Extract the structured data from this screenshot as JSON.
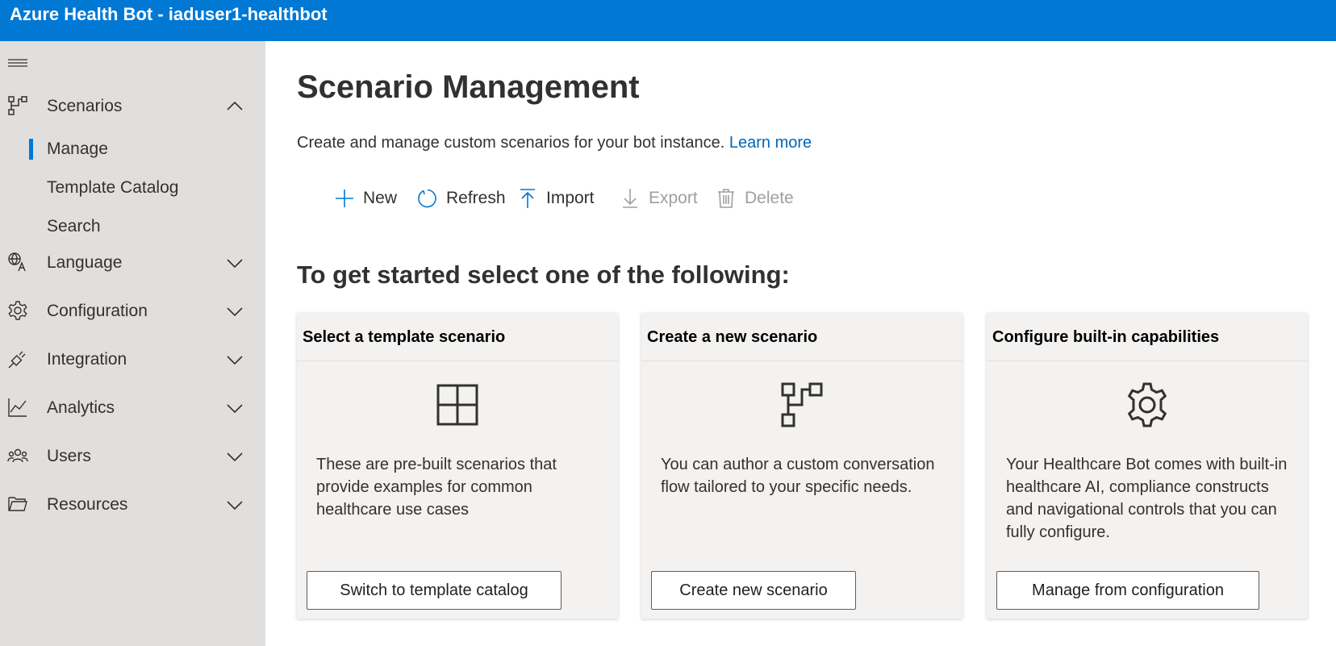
{
  "app": {
    "title": "Azure Health Bot - iaduser1-healthbot"
  },
  "colors": {
    "brand": "#0078d4",
    "link": "#0067b8",
    "sidebar_bg": "#e1dfdd",
    "card_bg": "#f3f2f1",
    "disabled": "#a19f9d"
  },
  "sidebar": {
    "menu_icon": "hamburger-icon",
    "items": [
      {
        "label": "Scenarios",
        "icon": "flow-icon",
        "expanded": true,
        "children": [
          {
            "label": "Manage",
            "selected": true
          },
          {
            "label": "Template Catalog",
            "selected": false
          },
          {
            "label": "Search",
            "selected": false
          }
        ]
      },
      {
        "label": "Language",
        "icon": "language-icon",
        "expanded": false
      },
      {
        "label": "Configuration",
        "icon": "gear-icon",
        "expanded": false
      },
      {
        "label": "Integration",
        "icon": "plug-icon",
        "expanded": false
      },
      {
        "label": "Analytics",
        "icon": "chart-icon",
        "expanded": false
      },
      {
        "label": "Users",
        "icon": "people-icon",
        "expanded": false
      },
      {
        "label": "Resources",
        "icon": "folder-icon",
        "expanded": false
      }
    ]
  },
  "main": {
    "title": "Scenario Management",
    "description": "Create and manage custom scenarios for your bot instance.",
    "learn_more": "Learn more",
    "commands": [
      {
        "label": "New",
        "icon": "plus-icon",
        "enabled": true
      },
      {
        "label": "Refresh",
        "icon": "refresh-icon",
        "enabled": true
      },
      {
        "label": "Import",
        "icon": "upload-icon",
        "enabled": true
      },
      {
        "label": "Export",
        "icon": "download-icon",
        "enabled": false
      },
      {
        "label": "Delete",
        "icon": "trash-icon",
        "enabled": false
      }
    ],
    "section_heading": "To get started select one of the following:",
    "cards": [
      {
        "title": "Select a template scenario",
        "icon": "grid-icon",
        "text": "These are pre-built scenarios that provide examples for common healthcare use cases",
        "button": "Switch to template catalog"
      },
      {
        "title": "Create a new scenario",
        "icon": "flow-icon",
        "text": "You can author a custom conversation flow tailored to your specific needs.",
        "button": "Create new scenario"
      },
      {
        "title": "Configure built-in capabilities",
        "icon": "gear-icon",
        "text": "Your Healthcare Bot comes with built-in healthcare AI, compliance constructs and navigational controls that you can fully configure.",
        "button": "Manage from configuration"
      }
    ]
  }
}
